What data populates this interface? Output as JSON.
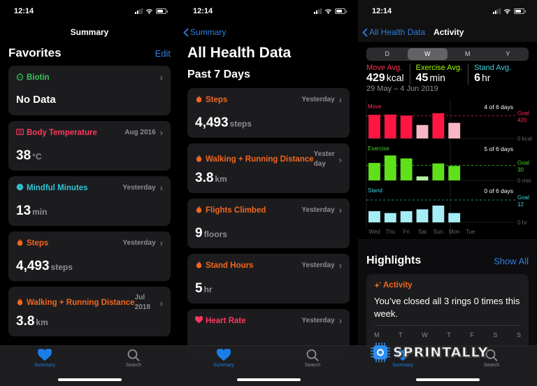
{
  "status_time": "12:14",
  "screens": {
    "summary": {
      "nav_title": "Summary",
      "section_title": "Favorites",
      "edit_label": "Edit",
      "cards": [
        {
          "title": "Biotin",
          "meta": "",
          "value": "No Data",
          "unit": "",
          "color": "#34c759",
          "icon": "apple-icon"
        },
        {
          "title": "Body Temperature",
          "meta": "Aug 2016",
          "value": "38",
          "unit": "°C",
          "color": "#ff375f",
          "icon": "thermometer-icon"
        },
        {
          "title": "Mindful Minutes",
          "meta": "Yesterday",
          "value": "13",
          "unit": "min",
          "color": "#2ec4d6",
          "icon": "flower-icon"
        },
        {
          "title": "Steps",
          "meta": "Yesterday",
          "value": "4,493",
          "unit": "steps",
          "color": "#f2661f",
          "icon": "flame-icon"
        },
        {
          "title": "Walking + Running Distance",
          "meta_line1": "Jul",
          "meta_line2": "2018",
          "value": "3.8",
          "unit": "km",
          "color": "#f2661f",
          "icon": "flame-icon"
        }
      ]
    },
    "all_data": {
      "back_label": "Summary",
      "title": "All Health Data",
      "section_title": "Past 7 Days",
      "cards": [
        {
          "title": "Steps",
          "meta": "Yesterday",
          "value": "4,493",
          "unit": "steps",
          "color": "#f2661f",
          "icon": "flame-icon"
        },
        {
          "title": "Walking + Running Distance",
          "meta_line1": "Yester",
          "meta_line2": "day",
          "value": "3.8",
          "unit": "km",
          "color": "#f2661f",
          "icon": "flame-icon"
        },
        {
          "title": "Flights Climbed",
          "meta": "Yesterday",
          "value": "9",
          "unit": "floors",
          "color": "#f2661f",
          "icon": "flame-icon"
        },
        {
          "title": "Stand Hours",
          "meta": "Yesterday",
          "value": "5",
          "unit": "hr",
          "color": "#f2661f",
          "icon": "flame-icon"
        },
        {
          "title": "Heart Rate",
          "meta": "Yesterday",
          "value": "",
          "unit": "",
          "color": "#ff375f",
          "icon": "heart-icon"
        }
      ]
    },
    "activity": {
      "back_label": "All Health Data",
      "nav_title": "Activity",
      "segments": [
        "D",
        "W",
        "M",
        "Y"
      ],
      "active_segment": "W",
      "averages": [
        {
          "label": "Move Avg.",
          "value": "429",
          "unit": "kcal",
          "color": "#ff2d55"
        },
        {
          "label": "Exercise Avg.",
          "value": "45",
          "unit": "min",
          "color": "#a6ff00"
        },
        {
          "label": "Stand Avg.",
          "value": "6",
          "unit": "hr",
          "color": "#3cd2e0"
        }
      ],
      "date_range": "29 May – 4 Jun 2019",
      "highlights_title": "Highlights",
      "show_all_label": "Show All",
      "highlight_card": {
        "title": "Activity",
        "message": "You’ve closed all 3 rings 0 times this week.",
        "days": [
          "M",
          "T",
          "W",
          "T",
          "F",
          "S",
          "S"
        ]
      }
    }
  },
  "tabbar": {
    "summary_label": "Summary",
    "search_label": "Search"
  },
  "watermark": "SPRINTALLY",
  "chart_data": {
    "type": "bar",
    "categories": [
      "Wed",
      "Thu",
      "Fri",
      "Sat",
      "Sun",
      "Mon",
      "Tue"
    ],
    "series": [
      {
        "name": "Move",
        "goal": 420,
        "goal_label": "Goal",
        "zero_label": "0 kcal",
        "summary": "4 of 6 days",
        "color": "#ff1744",
        "light_color": "#f8b6c4",
        "values": [
          440,
          445,
          425,
          250,
          470,
          290,
          null
        ],
        "goal_met": [
          true,
          true,
          true,
          false,
          true,
          false,
          false
        ],
        "max": 520
      },
      {
        "name": "Exercise",
        "goal": 30,
        "goal_label": "Goal",
        "zero_label": "0 min",
        "summary": "5 of 6 days",
        "color": "#5ee01a",
        "light_color": "#b6f0a0",
        "values": [
          35,
          50,
          44,
          8,
          34,
          29,
          null
        ],
        "goal_met": [
          true,
          true,
          true,
          false,
          true,
          true,
          false
        ],
        "max": 56
      },
      {
        "name": "Stand",
        "goal": 12,
        "goal_label": "Goal",
        "zero_label": "0 hr",
        "summary": "0 of 6 days",
        "color": "#a6ecf5",
        "light_color": "#a6ecf5",
        "values": [
          6,
          5,
          6,
          7,
          9,
          5,
          null
        ],
        "goal_met": [
          false,
          false,
          false,
          false,
          false,
          false,
          false
        ],
        "max": 15
      }
    ]
  }
}
